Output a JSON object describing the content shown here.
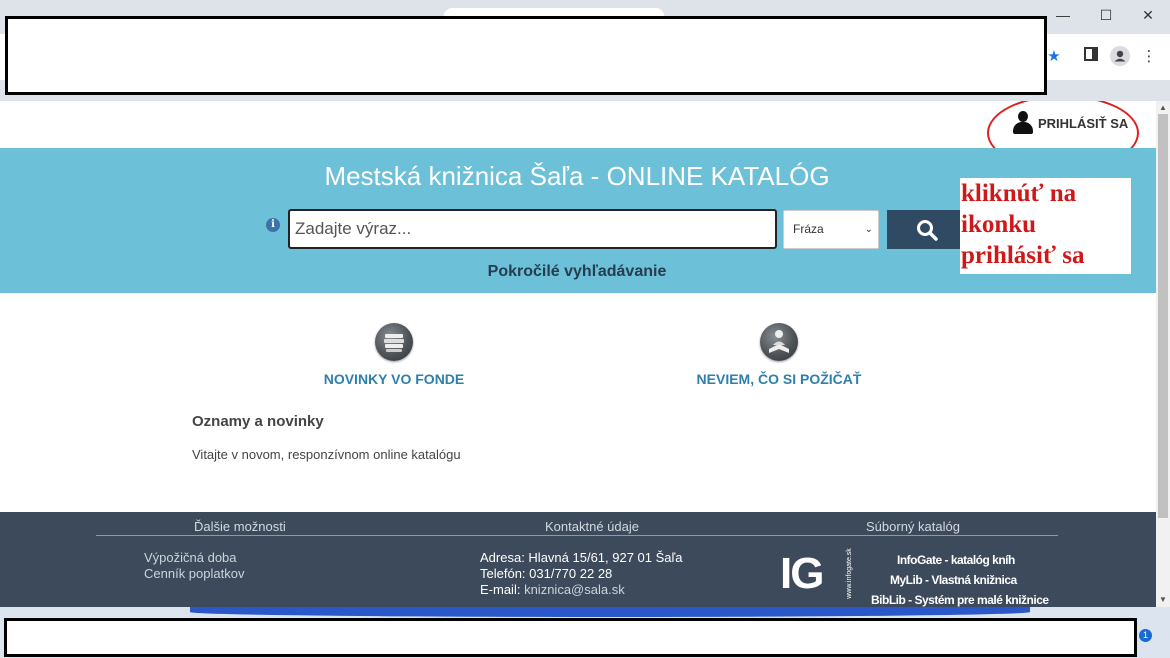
{
  "browser": {
    "minimize_glyph": "—",
    "maximize_glyph": "☐",
    "close_glyph": "✕",
    "icons": [
      "star-icon",
      "sidepanel-icon",
      "profile-icon",
      "kebab-menu-icon"
    ]
  },
  "header": {
    "login_label": "PRIHLÁSIŤ SA"
  },
  "annotation": {
    "line1": "kliknúť na",
    "line2": "ikonku",
    "line3": "prihlásiť sa",
    "color": "#e02020"
  },
  "hero": {
    "title": "Mestská knižnica Šaľa - ONLINE KATALÓG",
    "info_glyph": "i",
    "search_placeholder": "Zadajte výraz...",
    "search_value": "",
    "mode_selected": "Fráza",
    "advanced_link": "Pokročilé vyhľadávanie",
    "background": "#6cc0d8"
  },
  "features": [
    {
      "label": "NOVINKY VO FONDE",
      "icon": "books-icon"
    },
    {
      "label": "NEVIEM, ČO SI POŽIČAŤ",
      "icon": "reader-icon"
    }
  ],
  "news": {
    "title": "Oznamy a novinky",
    "text": "Vitajte v novom, responzívnom online katalógu"
  },
  "footer": {
    "col1_heading": "Ďalšie možnosti",
    "col2_heading": "Kontaktné údaje",
    "col3_heading": "Súborný katalóg",
    "links": [
      "Výpožičná doba",
      "Cenník poplatkov"
    ],
    "address": "Adresa: Hlavná 15/61, 927 01 Šaľa",
    "phone": "Telefón: 031/770 22 28",
    "email_label": "E-mail:",
    "email": "kniznica@sala.sk",
    "logo_text": "IG",
    "logo_url": "www.infogate.sk",
    "union": [
      "InfoGate - katalóg kníh",
      "MyLib - Vlastná knižnica",
      "BibLib - Systém pre malé knižnice"
    ],
    "background": "#3c4a5b"
  },
  "taskbar": {
    "notification_count": "1"
  }
}
